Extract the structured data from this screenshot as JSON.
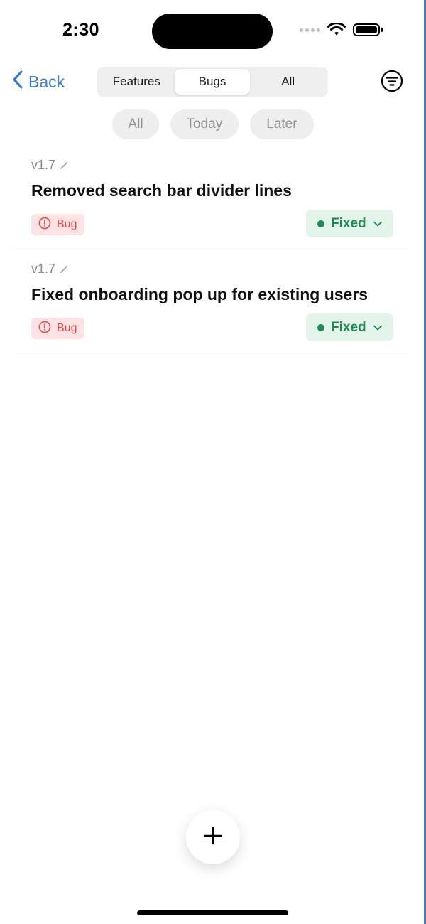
{
  "status_bar": {
    "time": "2:30"
  },
  "nav": {
    "back_label": "Back"
  },
  "segments": [
    {
      "label": "Features",
      "active": false
    },
    {
      "label": "Bugs",
      "active": true
    },
    {
      "label": "All",
      "active": false
    }
  ],
  "chips": [
    "All",
    "Today",
    "Later"
  ],
  "items": [
    {
      "version": "v1.7",
      "title": "Removed search bar divider lines",
      "tag": "Bug",
      "status": "Fixed"
    },
    {
      "version": "v1.7",
      "title": "Fixed onboarding pop up for existing users",
      "tag": "Bug",
      "status": "Fixed"
    }
  ],
  "icons": {
    "back": "chevron-left-icon",
    "filter": "filter-icon",
    "add": "plus-icon",
    "tag": "alert-circle-icon",
    "edit": "pencil-icon",
    "dropdown": "chevron-down-icon"
  },
  "colors": {
    "accent": "#3a7bd5",
    "bug_bg": "#fde3e3",
    "bug_fg": "#e04848",
    "fixed_bg": "#e3f4ea",
    "fixed_fg": "#1f8a52"
  }
}
